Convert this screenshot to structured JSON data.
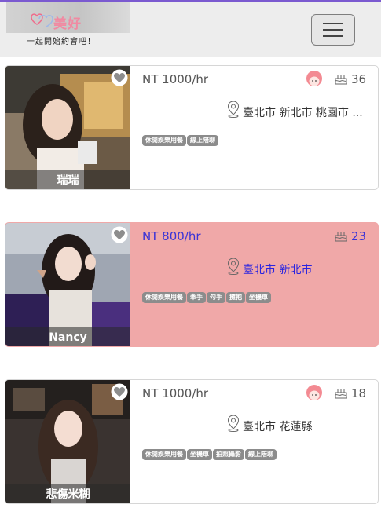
{
  "header": {
    "logo_text": "美好",
    "tagline": "一起開始約會吧！",
    "menu_icon": "hamburger-icon"
  },
  "cards": [
    {
      "name": "瑞瑞",
      "price": "NT 1000/hr",
      "age": "36",
      "location": "臺北市 新北市 桃園市 ...",
      "tags": [
        "休閒娛樂用餐",
        "線上陪聊"
      ],
      "has_avatar_icon": true,
      "highlight": false
    },
    {
      "name": "Nancy",
      "price": "NT 800/hr",
      "age": "23",
      "location": "臺北市 新北市",
      "tags": [
        "休閒娛樂用餐",
        "牽手",
        "勾手",
        "擁抱",
        "坐機車"
      ],
      "has_avatar_icon": false,
      "highlight": true
    },
    {
      "name": "悲傷米糊",
      "price": "NT 1000/hr",
      "age": "18",
      "location": "臺北市 花蓮縣",
      "tags": [
        "休閒娛樂用餐",
        "坐機車",
        "拍照攝影",
        "線上陪聊"
      ],
      "has_avatar_icon": true,
      "highlight": false
    }
  ],
  "colors": {
    "accent_line": "#7b5ad0",
    "highlight_bg": "#f0a8a8",
    "highlight_text": "#3a33d6",
    "tag_bg": "#8c8c8c",
    "avatar_pink": "#f38a92"
  }
}
